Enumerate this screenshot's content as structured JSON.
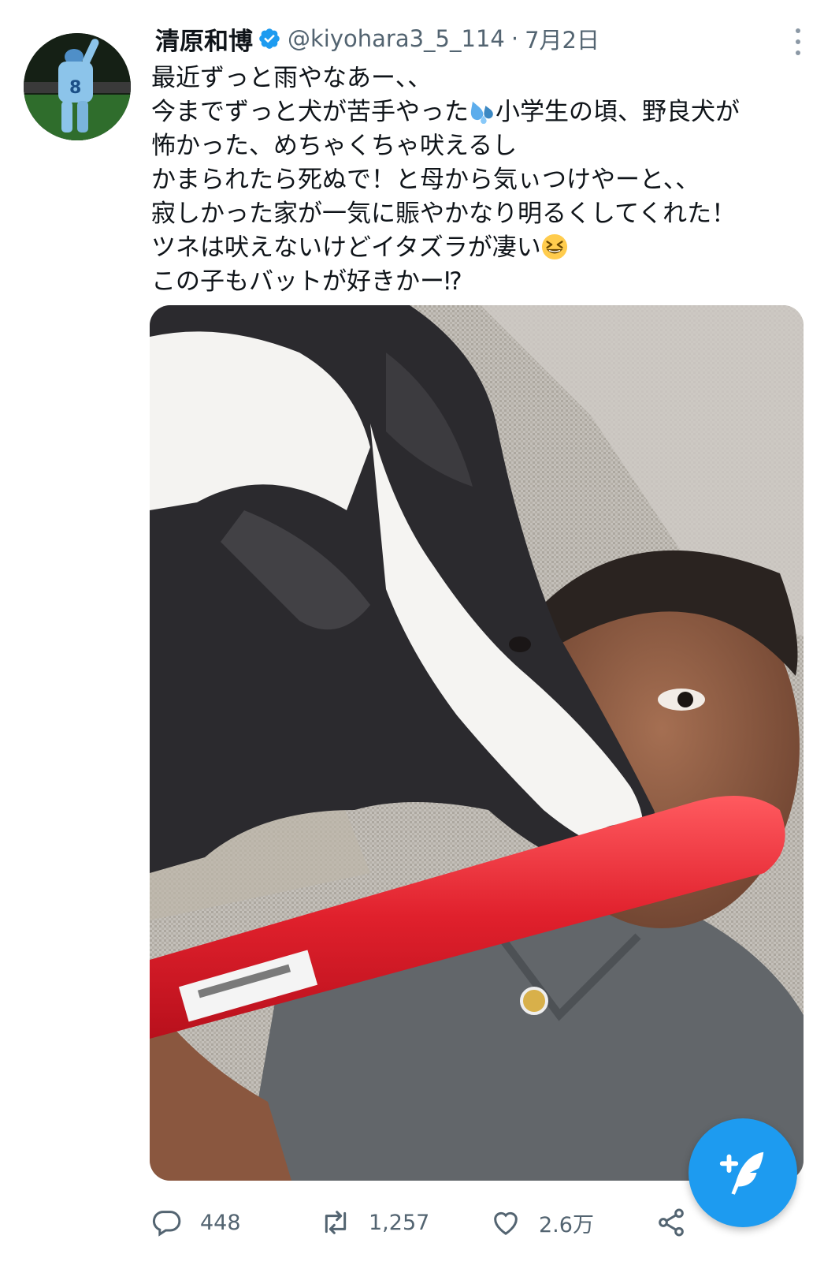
{
  "tweet": {
    "display_name": "清原和博",
    "handle": "@kiyohara3_5_114",
    "separator": "·",
    "date": "7月2日",
    "verified": true,
    "lines": [
      "最近ずっと雨やなあー、、",
      "今までずっと犬が苦手やった",
      "小学生の頃、野良犬が",
      "怖かった、めちゃくちゃ吠えるし",
      "かまられたら死ぬで！と母から気ぃつけやーと、、",
      "寂しかった家が一気に賑やかなり明るくしてくれた！",
      "ツネは吠えないけどイタズラが凄い",
      "この子もバットが好きかー⁉"
    ],
    "emojis": [
      "sweat-droplets-emoji",
      "grinning-squinting-face-emoji"
    ]
  },
  "actions": {
    "reply_count": "448",
    "retweet_count": "1,257",
    "like_count": "2.6万"
  },
  "icons": {
    "reply": "reply-icon",
    "retweet": "retweet-icon",
    "like": "heart-icon",
    "share": "share-icon",
    "more": "more-vertical-icon",
    "compose": "compose-tweet-icon",
    "verified": "verified-badge-icon"
  },
  "colors": {
    "accent": "#1d9bf0",
    "text": "#0f1419",
    "secondary_text": "#536471"
  }
}
